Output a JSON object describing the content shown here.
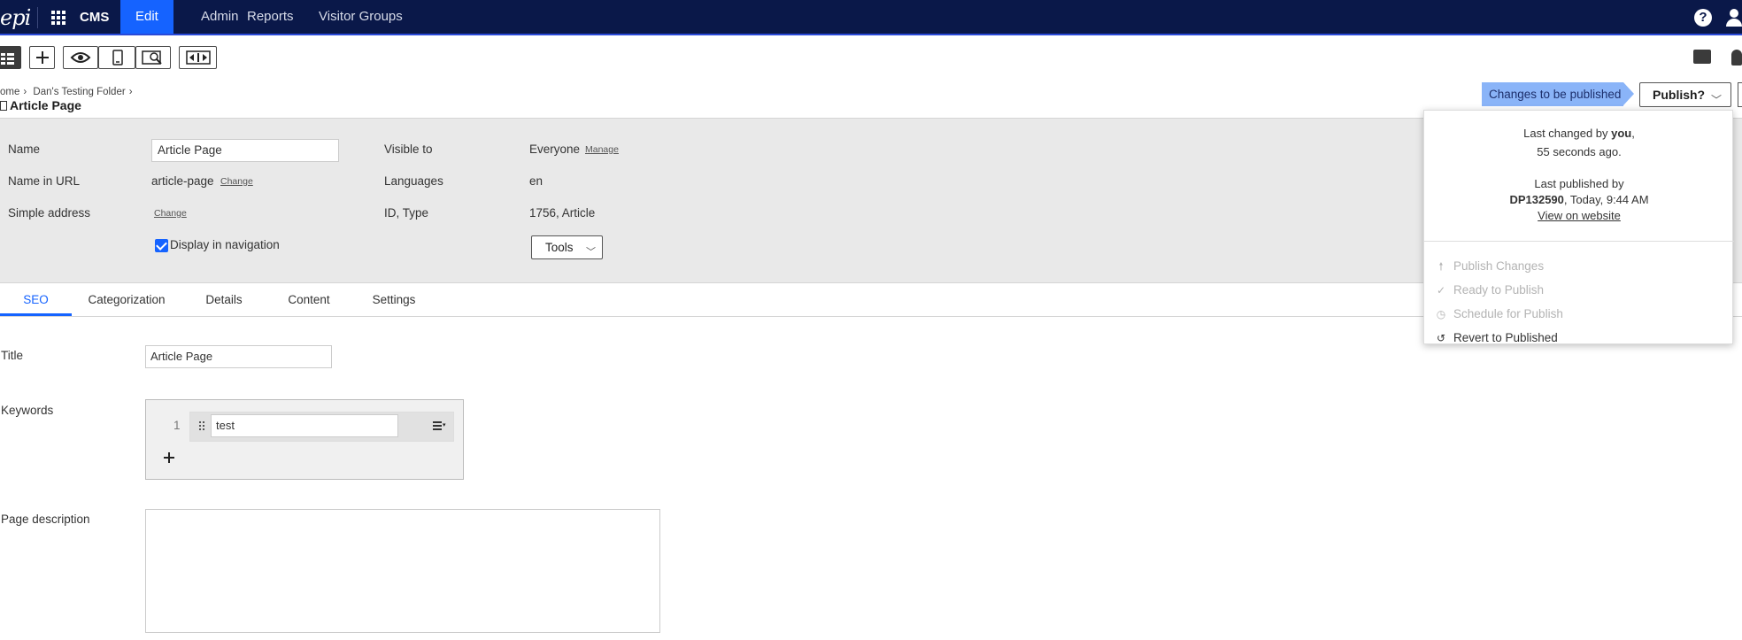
{
  "topnav": {
    "logo": "epi",
    "product": "CMS",
    "items": [
      {
        "label": "Edit",
        "active": true
      },
      {
        "label": "Admin",
        "active": false
      },
      {
        "label": "Reports",
        "active": false
      },
      {
        "label": "Visitor Groups",
        "active": false
      }
    ],
    "help_label": "?",
    "accent_color": "#1563ff",
    "bar_color": "#0a1849"
  },
  "toolbar": {
    "icons": [
      "page-tree-icon",
      "add-icon",
      "preview-icon",
      "mobile-view-icon",
      "zoom-preview-icon",
      "compare-icon",
      "comments-icon",
      "notifications-icon"
    ]
  },
  "breadcrumb": {
    "items": [
      "ome",
      "Dan's Testing Folder"
    ],
    "page_title": "Article Page"
  },
  "publishing": {
    "status": "Changes to be published",
    "publish_button": "Publish?",
    "last_changed_prefix": "Last changed by ",
    "last_changed_by": "you",
    "last_changed_suffix": ",",
    "last_changed_time": "55 seconds ago.",
    "last_published_label": "Last published by",
    "last_published_by": "DP132590",
    "last_published_time": ", Today, 9:44 AM",
    "view_on_website": "View on website",
    "actions": [
      {
        "label": "Publish Changes",
        "icon": "upload-icon",
        "enabled": false
      },
      {
        "label": "Ready to Publish",
        "icon": "check-icon",
        "enabled": false
      },
      {
        "label": "Schedule for Publish",
        "icon": "clock-icon",
        "enabled": false
      },
      {
        "label": "Revert to Published",
        "icon": "revert-icon",
        "enabled": true
      }
    ]
  },
  "properties": {
    "name_label": "Name",
    "name_value": "Article Page",
    "url_label": "Name in URL",
    "url_value": "article-page",
    "url_change": "Change",
    "simple_address_label": "Simple address",
    "simple_address_change": "Change",
    "display_in_nav": "Display in navigation",
    "display_in_nav_checked": true,
    "visible_label": "Visible to",
    "visible_value": "Everyone",
    "visible_manage": "Manage",
    "languages_label": "Languages",
    "languages_value": "en",
    "id_type_label": "ID, Type",
    "id_type_value": "1756, Article",
    "tools_label": "Tools"
  },
  "tabs": [
    {
      "label": "SEO",
      "active": true
    },
    {
      "label": "Categorization",
      "active": false
    },
    {
      "label": "Details",
      "active": false
    },
    {
      "label": "Content",
      "active": false
    },
    {
      "label": "Settings",
      "active": false
    }
  ],
  "seo": {
    "title_label": "Title",
    "title_value": "Article Page",
    "keywords_label": "Keywords",
    "keywords": [
      {
        "index": "1",
        "value": "test"
      }
    ],
    "description_label": "Page description",
    "description_value": ""
  }
}
